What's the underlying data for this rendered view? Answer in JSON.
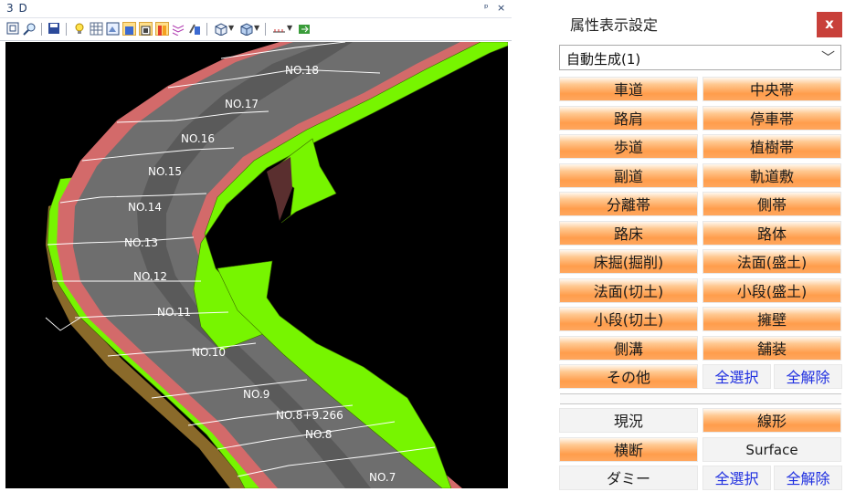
{
  "viewer": {
    "title": "3 D",
    "pin": "ᵖ",
    "close": "×",
    "stations": [
      "NO.18",
      "NO.17",
      "NO.16",
      "NO.15",
      "NO.14",
      "NO.13",
      "NO.12",
      "NO.11",
      "NO.10",
      "NO.9",
      "NO.8+9.266",
      "NO.8",
      "NO.7"
    ]
  },
  "panel": {
    "title": "属性表示設定",
    "close": "x",
    "dropdown_value": "自動生成(1)",
    "buttons": [
      [
        "車道",
        "中央帯"
      ],
      [
        "路肩",
        "停車帯"
      ],
      [
        "歩道",
        "植樹帯"
      ],
      [
        "副道",
        "軌道敷"
      ],
      [
        "分離帯",
        "側帯"
      ],
      [
        "路床",
        "路体"
      ],
      [
        "床掘(掘削)",
        "法面(盛土)"
      ],
      [
        "法面(切土)",
        "小段(盛土)"
      ],
      [
        "小段(切土)",
        "擁壁"
      ],
      [
        "側溝",
        "舗装"
      ]
    ],
    "other": "その他",
    "select_all": "全選択",
    "clear_all": "全解除",
    "layers": {
      "existing": "現況",
      "alignment": "線形",
      "cross_section": "横断",
      "surface": "Surface",
      "dummy": "ダミー",
      "select_all": "全選択",
      "clear_all": "全解除"
    }
  },
  "colors": {
    "road": "#6e6e6e",
    "curb": "#d36a6a",
    "slope": "#77f500",
    "retaining_wall": "#5a2f2f",
    "button_orange": "#ff9d4c",
    "close_red": "#c8403a",
    "link_blue": "#1f2fe0"
  },
  "icons": [
    "zoom-fit-icon",
    "zoom-icon",
    "save-icon",
    "light-bulb-icon",
    "grid-icon",
    "view-icon",
    "layer-icon",
    "texture-icon",
    "attribute-icon",
    "hatch-icon",
    "settings-icon",
    "cube-view-icon",
    "cube-shade-icon",
    "measure-icon",
    "export-icon"
  ]
}
